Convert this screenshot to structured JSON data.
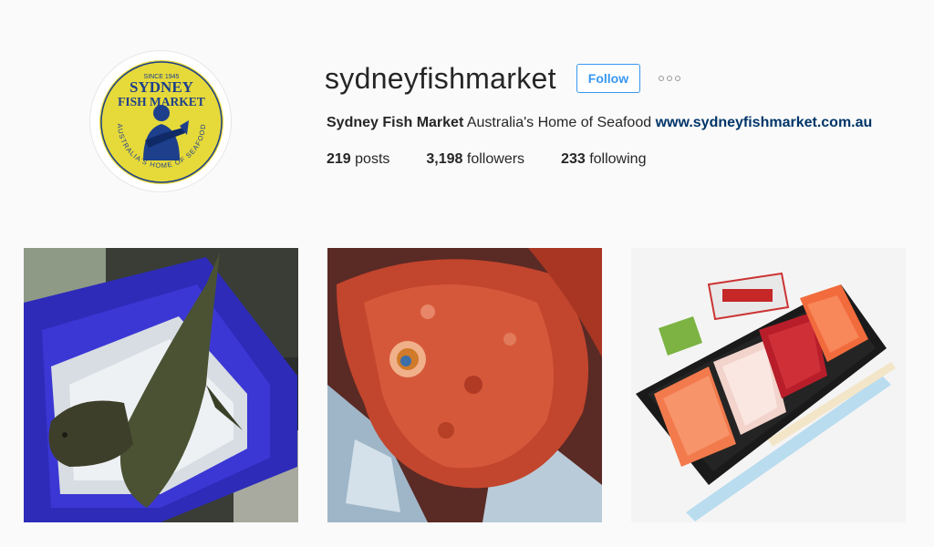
{
  "profile": {
    "username": "sydneyfishmarket",
    "follow_label": "Follow",
    "bio": {
      "name": "Sydney Fish Market",
      "text": "Australia's Home of Seafood",
      "link": "www.sydneyfishmarket.com.au"
    },
    "stats": {
      "posts_count": "219",
      "posts_label": "posts",
      "followers_count": "3,198",
      "followers_label": "followers",
      "following_count": "233",
      "following_label": "following"
    },
    "avatar": {
      "logo_top": "SYDNEY",
      "logo_line2": "FISH MARKET",
      "since": "SINCE 1945",
      "ring_text": "AUSTRALIA'S HOME OF SEAFOOD"
    }
  },
  "posts": [
    {
      "subject": "flathead fish in blue crate with ice"
    },
    {
      "subject": "red scorpion fish on ice"
    },
    {
      "subject": "sashimi platter with soy sauce and chopsticks"
    }
  ],
  "colors": {
    "accent": "#3897f0",
    "link": "#003569",
    "logo_yellow": "#e6d93a",
    "logo_blue": "#1d3f8c"
  }
}
